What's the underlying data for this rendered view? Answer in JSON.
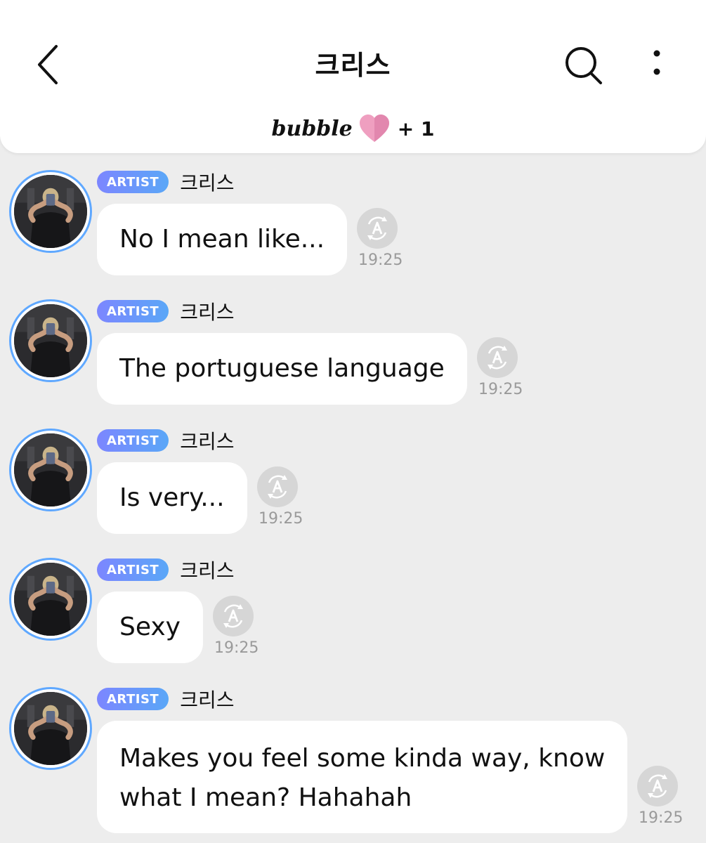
{
  "header": {
    "title": "크리스",
    "subtitle_brand": "bubble",
    "subtitle_count": "+ 1",
    "back_icon": "chevron-left-icon",
    "search_icon": "search-icon",
    "more_icon": "more-vertical-icon",
    "heart_icon": "heart-icon",
    "heart_color": "#e98fb4"
  },
  "colors": {
    "background": "#ededed",
    "badge_gradient_start": "#7c86ff",
    "badge_gradient_end": "#5aa7f7",
    "avatar_ring": "#5fa8ff",
    "timestamp": "#9a9a9a"
  },
  "messages": [
    {
      "badge": "ARTIST",
      "sender": "크리스",
      "text_lines": [
        "No I mean like..."
      ],
      "time": "19:25"
    },
    {
      "badge": "ARTIST",
      "sender": "크리스",
      "text_lines": [
        "The portuguese language"
      ],
      "time": "19:25"
    },
    {
      "badge": "ARTIST",
      "sender": "크리스",
      "text_lines": [
        "Is very..."
      ],
      "time": "19:25"
    },
    {
      "badge": "ARTIST",
      "sender": "크리스",
      "text_lines": [
        "Sexy"
      ],
      "time": "19:25"
    },
    {
      "badge": "ARTIST",
      "sender": "크리스",
      "text_lines": [
        "Makes you feel some kinda way, know",
        "what I mean? Hahahah"
      ],
      "time": "19:25"
    }
  ]
}
